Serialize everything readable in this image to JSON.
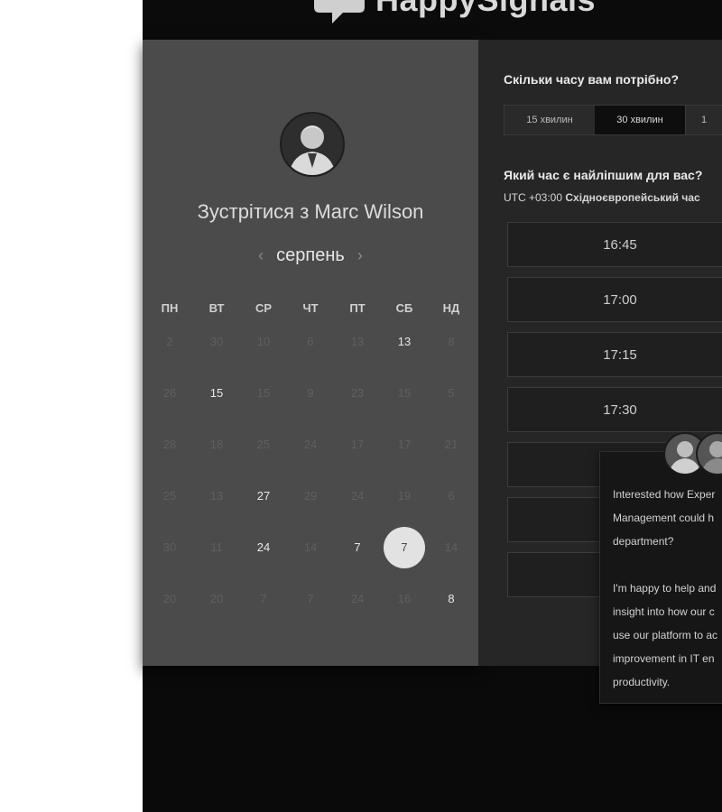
{
  "brand": {
    "name": "HappySignals"
  },
  "meeting": {
    "title": "Зустрітися з Marc Wilson"
  },
  "calendar": {
    "month": "серпень",
    "prev_arrow": "‹",
    "next_arrow": "›",
    "weekdays": [
      "ПН",
      "ВТ",
      "СР",
      "ЧТ",
      "ПТ",
      "СБ",
      "НД"
    ],
    "weeks": [
      [
        "2",
        "30",
        "10",
        "6",
        "13",
        "13",
        "8"
      ],
      [
        "26",
        "15",
        "15",
        "9",
        "23",
        "15",
        "5"
      ],
      [
        "28",
        "18",
        "25",
        "24",
        "17",
        "17",
        "21"
      ],
      [
        "25",
        "13",
        "27",
        "29",
        "24",
        "19",
        "6"
      ],
      [
        "30",
        "11",
        "24",
        "14",
        "7",
        "7",
        "14"
      ],
      [
        "20",
        "20",
        "7",
        "7",
        "24",
        "16",
        "8"
      ]
    ]
  },
  "duration": {
    "question": "Скільки часу вам потрібно?",
    "options": [
      "15 хвилин",
      "30 хвилин",
      "1"
    ]
  },
  "time": {
    "question": "Який час є найліпшим для вас?",
    "timezone_offset": "UTC +03:00",
    "timezone_name": "Східноєвропейський час",
    "slots": [
      "16:45",
      "17:00",
      "17:15",
      "17:30",
      "",
      "",
      ""
    ]
  },
  "popup": {
    "text": "Interested how Exper\nManagement could h\ndepartment?\n\nI'm happy to help and\ninsight into how our c\nuse our platform to ac\nimprovement in IT en\nproductivity."
  }
}
